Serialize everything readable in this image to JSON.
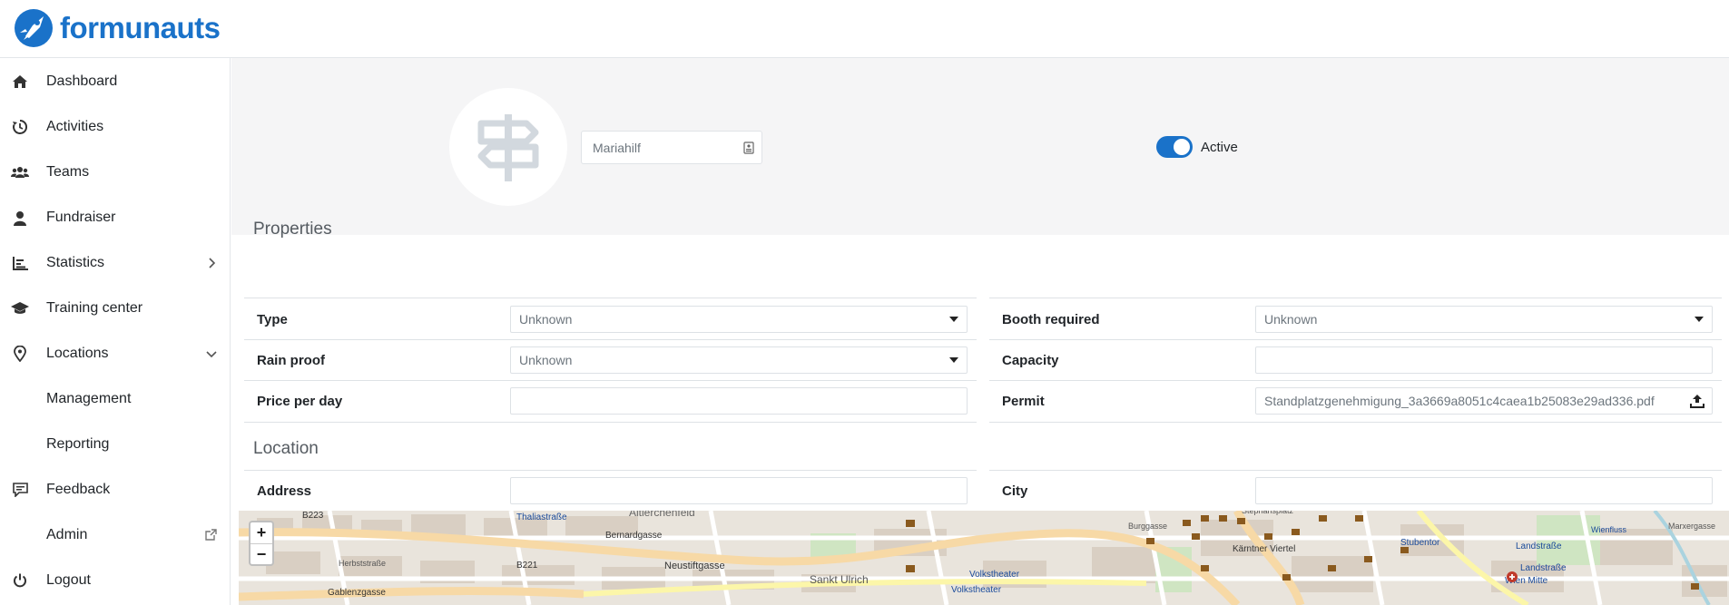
{
  "brand": {
    "name": "formunauts",
    "color": "#1a72c9"
  },
  "nav": {
    "items": [
      {
        "label": "Dashboard",
        "icon": "home-icon"
      },
      {
        "label": "Activities",
        "icon": "history-icon"
      },
      {
        "label": "Teams",
        "icon": "users-icon"
      },
      {
        "label": "Fundraiser",
        "icon": "user-icon"
      },
      {
        "label": "Statistics",
        "icon": "chart-icon",
        "caret": "chevron-right-icon"
      },
      {
        "label": "Training center",
        "icon": "graduation-cap-icon"
      },
      {
        "label": "Locations",
        "icon": "map-pin-icon",
        "caret": "chevron-down-icon",
        "expanded": true
      },
      {
        "label": "Management"
      },
      {
        "label": "Reporting"
      },
      {
        "label": "Feedback",
        "icon": "comment-icon"
      },
      {
        "label": "Admin",
        "trailing_icon": "external-link-icon"
      },
      {
        "label": "Logout",
        "icon": "power-icon"
      }
    ]
  },
  "location": {
    "name": "Mariahilf",
    "avatar_icon": "signpost-icon",
    "active_label": "Active",
    "active": true
  },
  "properties": {
    "title": "Properties",
    "type_label": "Type",
    "type_value": "Unknown",
    "rain_proof_label": "Rain proof",
    "rain_proof_value": "Unknown",
    "price_label": "Price per day",
    "price_value": "",
    "booth_label": "Booth required",
    "booth_value": "Unknown",
    "capacity_label": "Capacity",
    "capacity_value": "",
    "permit_label": "Permit",
    "permit_value": "Standplatzgenehmigung_3a3669a8051c4caea1b25083e29ad336.pdf"
  },
  "location_section": {
    "title": "Location",
    "address_label": "Address",
    "address_value": "",
    "city_label": "City",
    "city_value": ""
  },
  "map": {
    "zoom_in": "+",
    "zoom_out": "−",
    "labels": [
      "B223",
      "Thaliastraße",
      "Altlerchenfeld",
      "Bernardgasse",
      "B221",
      "Neustiftgasse",
      "Sankt Ulrich",
      "Gablenzgasse",
      "Volkstheater",
      "Volkstheater",
      "Kärntner Viertel",
      "Stubentor",
      "Landstraße",
      "Landstraße",
      "Wien Mitte",
      "Herbststraße",
      "Burggasse",
      "Stephansplatz",
      "Wienfluss",
      "Marxergasse"
    ]
  }
}
